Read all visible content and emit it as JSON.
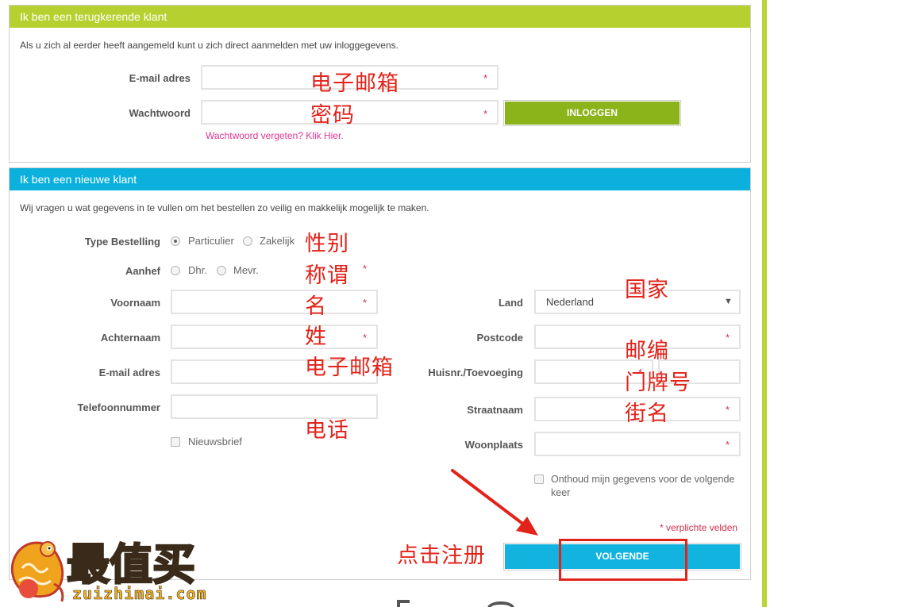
{
  "returning": {
    "header": "Ik ben een terugkerende klant",
    "intro": "Als u zich al eerder heeft aangemeld kunt u zich direct aanmelden met uw inloggegevens.",
    "email_label": "E-mail adres",
    "password_label": "Wachtwoord",
    "login_button": "INLOGGEN",
    "forgot_link": "Wachtwoord vergeten? Klik Hier."
  },
  "new_customer": {
    "header": "Ik ben een nieuwe klant",
    "intro": "Wij vragen u wat gegevens in te vullen om het bestellen zo veilig en makkelijk mogelijk te maken.",
    "type_label": "Type Bestelling",
    "type_options": [
      "Particulier",
      "Zakelijk"
    ],
    "salutation_label": "Aanhef",
    "salutation_options": [
      "Dhr.",
      "Mevr."
    ],
    "firstname_label": "Voornaam",
    "lastname_label": "Achternaam",
    "email_label": "E-mail adres",
    "phone_label": "Telefoonnummer",
    "newsletter_label": "Nieuwsbrief",
    "country_label": "Land",
    "country_value": "Nederland",
    "postcode_label": "Postcode",
    "housenr_label": "Huisnr./Toevoeging",
    "street_label": "Straatnaam",
    "city_label": "Woonplaats",
    "remember_label": "Onthoud mijn gegevens voor de volgende keer",
    "required_note": "* verplichte velden",
    "next_button": "VOLGENDE"
  },
  "annotations": {
    "email": "电子邮箱",
    "password": "密码",
    "gender": "性别",
    "salutation": "称谓",
    "firstname": "名",
    "lastname": "姓",
    "email2": "电子邮箱",
    "phone": "电话",
    "country": "国家",
    "postcode": "邮编",
    "housenr": "门牌号",
    "street": "街名",
    "register": "点击注册"
  },
  "required_mark": "*",
  "watermark": {
    "brand": "最值买",
    "domain": "zuizhimai.com"
  },
  "colors": {
    "green": "#b6d12f",
    "cyan": "#0bb1dc",
    "red_annotation": "#e2231a",
    "link_pink": "#e0358e"
  }
}
